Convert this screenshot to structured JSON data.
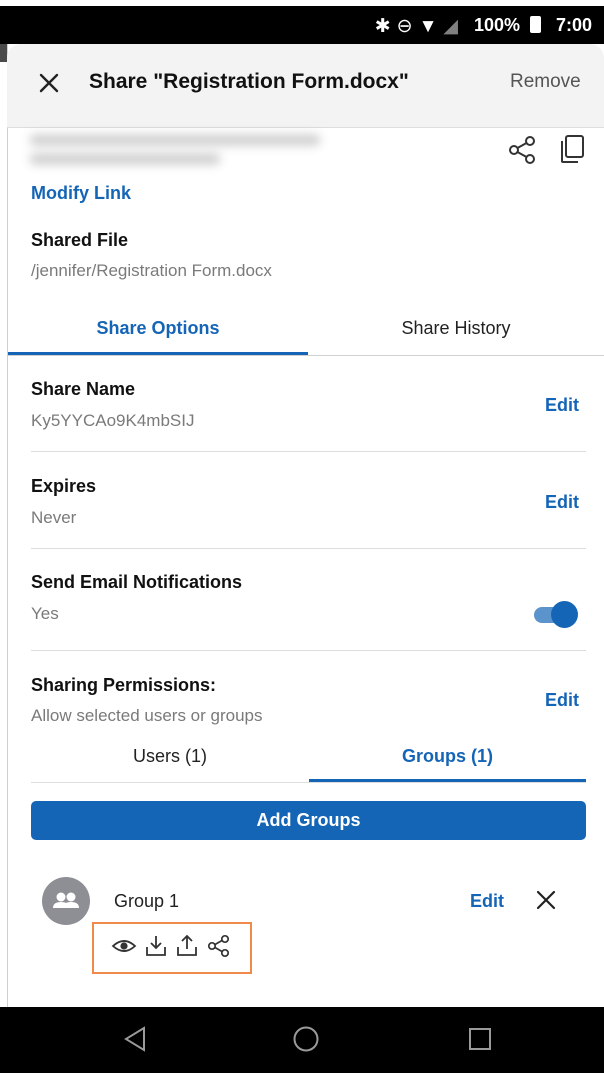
{
  "status_bar": {
    "icons": [
      "bluetooth-icon",
      "do-not-disturb-icon",
      "wifi-icon",
      "signal-icon"
    ],
    "battery_text": "100%",
    "time": "7:00"
  },
  "header": {
    "title": "Share \"Registration Form.docx\"",
    "remove_label": "Remove",
    "close_icon": "close-icon"
  },
  "link": {
    "modify_label": "Modify Link",
    "share_icon": "share-icon",
    "copy_icon": "copy-icon"
  },
  "shared_file": {
    "label": "Shared File",
    "path": "/jennifer/Registration Form.docx"
  },
  "tabs": [
    {
      "label": "Share Options",
      "active": true
    },
    {
      "label": "Share History",
      "active": false
    }
  ],
  "options": {
    "share_name": {
      "label": "Share Name",
      "value": "Ky5YYCAo9K4mbSIJ",
      "edit_label": "Edit"
    },
    "expires": {
      "label": "Expires",
      "value": "Never",
      "edit_label": "Edit"
    },
    "notifications": {
      "label": "Send Email Notifications",
      "value": "Yes",
      "toggle_on": true
    },
    "permissions": {
      "label": "Sharing Permissions:",
      "value": "Allow selected users or groups",
      "edit_label": "Edit"
    }
  },
  "subtabs": [
    {
      "label": "Users (1)",
      "active": false
    },
    {
      "label": "Groups (1)",
      "active": true
    }
  ],
  "add_groups_label": "Add Groups",
  "groups": [
    {
      "name": "Group 1",
      "edit_label": "Edit",
      "permission_icons": [
        "view-icon",
        "download-icon",
        "upload-icon",
        "share-icon"
      ]
    }
  ],
  "colors": {
    "accent": "#1565b7",
    "highlight_border": "#ee8a4a",
    "avatar_bg": "#8d8f95"
  }
}
